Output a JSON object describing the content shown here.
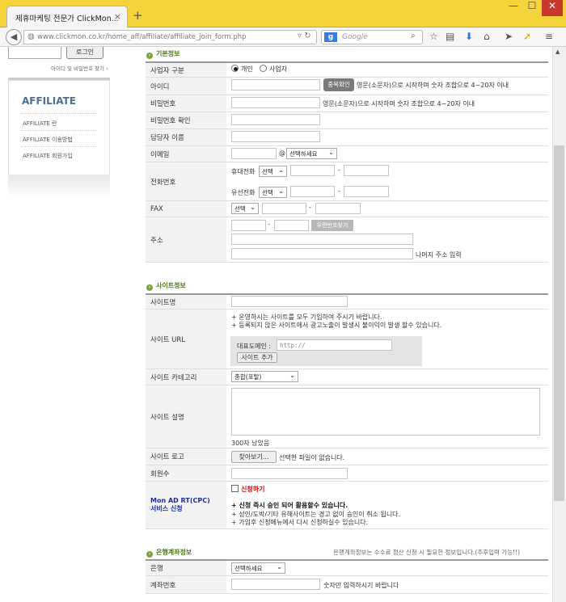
{
  "browser": {
    "tab_title": "제휴마케팅 전문가 ClickMon...",
    "tab_close": "×",
    "new_tab": "+",
    "window_controls": [
      "—",
      "☐",
      "✕"
    ],
    "url": "www.clickmon.co.kr/home_aff/affiliate/affiliate_join_form.php",
    "search_engine": "g",
    "search_placeholder": "Google",
    "accent_color": "#f4d33b"
  },
  "sidebar": {
    "login_button": "로그인",
    "find_link": "아이디 및 비밀번호 찾기",
    "affiliate_title": "AFFILIATE",
    "menu": [
      "AFFILIATE 란",
      "AFFILIATE 이용방법",
      "AFFILIATE 회원가입"
    ]
  },
  "basic": {
    "section_title": "기본정보",
    "member_type_label": "사업자 구분",
    "type_personal": "개인",
    "type_business": "사업자",
    "id_label": "아이디",
    "dup_check_button": "중복확인",
    "id_hint": "영문(소문자)으로 시작하며 숫자 조합으로 4~20자 이내",
    "pw_label": "비밀번호",
    "pw_hint": "영문(소문자)으로 시작하며 숫자 조합으로 4~20자 이내",
    "pw_confirm_label": "비밀번호 확인",
    "manager_label": "담당자 이름",
    "email_label": "이메일",
    "email_at": "@",
    "email_select": "선택하세요",
    "phone_label": "전화번호",
    "mobile_label": "휴대전화",
    "landline_label": "유선전화",
    "select_default": "선택",
    "dash": "-",
    "fax_label": "FAX",
    "address_label": "주소",
    "zip_button": "우편번호찾기",
    "address_rest": "나머지 주소 입력"
  },
  "site": {
    "section_title": "사이트정보",
    "name_label": "사이트명",
    "url_label": "사이트 URL",
    "url_note1": "+ 운영하시는 사이트를 모두 기입하여 주시기 바랍니다.",
    "url_note2": "+ 등록되지 않은 사이트에서 광고노출이 발생시 불이익이 발생 할수 있습니다.",
    "main_domain_label": "대표도메인 :",
    "url_placeholder": "http://",
    "add_site_button": "사이트 추가",
    "category_label": "사이트 카테고리",
    "category_value": "종합(포탈)",
    "desc_label": "사이트 설명",
    "desc_remaining": "300자 남았음",
    "logo_label": "사이트 로고",
    "browse_button": "찾아보기...",
    "no_file": "선택한 파일이 없습니다.",
    "members_label": "회원수",
    "cpc_label_1": "Mon AD RT(CPC)",
    "cpc_label_2": "서비스 신청",
    "cpc_apply": "신청하기",
    "cpc_note1": "+ 신청 즉시 승인 되어 활용할수 있습니다.",
    "cpc_note2": "+ 성인/도박/기타 유해사이트는 경고 없이 승인이 취소 됩니다.",
    "cpc_note3": "+ 가입후 신청메뉴에서 다시 신청하실수 있습니다."
  },
  "bank": {
    "section_title": "은행계좌정보",
    "note": "은행계좌정보는 수수료 정산 신청 시 필요한 정보입니다.(추후입력 가능!!)",
    "bank_label": "은행",
    "bank_select": "선택하세요",
    "account_label": "계좌번호",
    "account_hint": "숫자만 입력하시기 바랍니다"
  }
}
